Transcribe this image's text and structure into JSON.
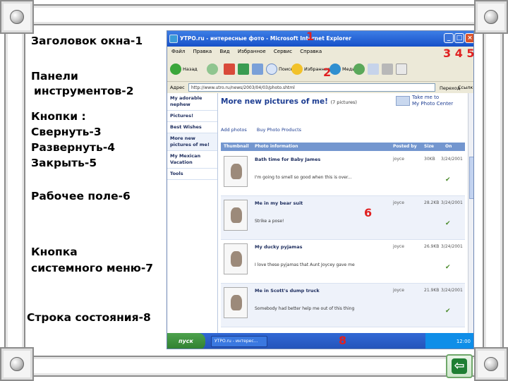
{
  "labels": {
    "title": "Заголовок окна-1",
    "toolbars_line1": "Панели",
    "toolbars_line2": "инструментов-2",
    "buttons_line1": "Кнопки :",
    "buttons_line2": "Свернуть-3",
    "buttons_line3": "Развернуть-4",
    "buttons_line4": "Закрыть-5",
    "workarea": "Рабочее поле-6",
    "sysmenu_line1": "Кнопка",
    "sysmenu_line2": "системного меню-7",
    "statusbar": "Строка состояния-8"
  },
  "markers": {
    "m1": "1",
    "m2": "2",
    "m345": "3 4 5",
    "m6": "6",
    "m8": "8"
  },
  "ie": {
    "title": "УТРО.ru - интересные фото - Microsoft Internet Explorer",
    "menu": [
      "Файл",
      "Правка",
      "Вид",
      "Избранное",
      "Сервис",
      "Справка"
    ],
    "toolbar": {
      "back": "Назад",
      "search": "Поиск",
      "favorites": "Избранное",
      "media": "Медиа"
    },
    "address_label": "Адрес",
    "address_value": "http://www.utro.ru/news/2003/04/03/photo.shtml",
    "go_label": "Переход",
    "links_label": "Ссылки",
    "sidenav": [
      "My adorable nephew",
      "Pictures!",
      "Best Wishes",
      "More new pictures of me!",
      "My Mexican Vacation",
      "Tools"
    ],
    "page_title": "More new pictures of me!",
    "page_count": "(7 pictures)",
    "photocenter_line1": "Take me to",
    "photocenter_line2": "My Photo Center",
    "action_add": "Add photos",
    "action_buy": "Buy Photo Products",
    "columns": [
      "Thumbnail",
      "Photo information",
      "Posted by",
      "Size",
      "On"
    ],
    "rows": [
      {
        "title": "Bath time for Baby James",
        "desc": "I'm going to smell so good when this is over...",
        "by": "joyce",
        "size": "30KB",
        "on": "3/24/2001"
      },
      {
        "title": "Me in my bear suit",
        "desc": "Strike a pose!",
        "by": "joyce",
        "size": "28.2KB",
        "on": "3/24/2001"
      },
      {
        "title": "My ducky pyjamas",
        "desc": "I love these pyjamas that Aunt Joycey gave me",
        "by": "joyce",
        "size": "26.9KB",
        "on": "3/24/2001"
      },
      {
        "title": "Me in Scott's dump truck",
        "desc": "Somebody had better help me out of this thing",
        "by": "joyce",
        "size": "21.9KB",
        "on": "3/24/2001"
      }
    ],
    "start_label": "пуск",
    "task_label": "УТРО.ru - интерес...",
    "tray_time": "12:00"
  }
}
